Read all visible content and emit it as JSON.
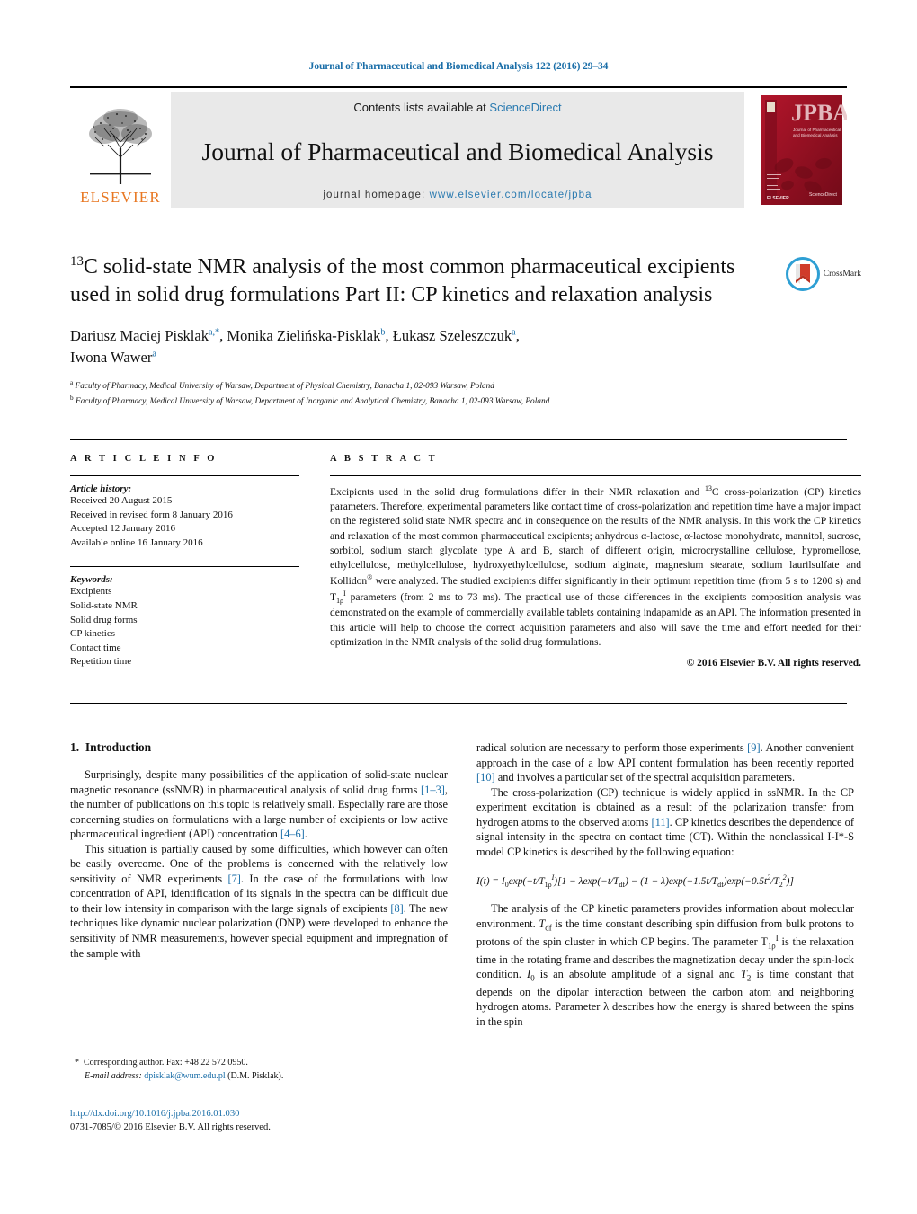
{
  "running_head": "Journal of Pharmaceutical and Biomedical Analysis 122 (2016) 29–34",
  "masthead": {
    "contents_prefix": "Contents lists available at ",
    "sciencedirect": "ScienceDirect",
    "journal_title": "Journal of Pharmaceutical and Biomedical Analysis",
    "homepage_prefix": "journal homepage: ",
    "homepage_url": "www.elsevier.com/locate/jpba",
    "publisher": "ELSEVIER",
    "cover_title": "JPBA",
    "cover_subtitle": "Journal of Pharmaceutical and Biomedical Analysis",
    "accent_orange": "#e87722",
    "accent_blue": "#2a7ab0",
    "cover_red": "#a8142a"
  },
  "article": {
    "title_line1_sup": "13",
    "title": "C solid-state NMR analysis of the most common pharmaceutical excipients used in solid drug formulations Part II: CP kinetics and relaxation analysis",
    "authors_html": "Dariusz Maciej Pisklak, Monika Zielińska-Pisklak, Łukasz Szeleszczuk, Iwona Wawer",
    "affiliation_a": "Faculty of Pharmacy, Medical University of Warsaw, Department of Physical Chemistry, Banacha 1, 02-093 Warsaw, Poland",
    "affiliation_b": "Faculty of Pharmacy, Medical University of Warsaw, Department of Inorganic and Analytical Chemistry, Banacha 1, 02-093 Warsaw, Poland",
    "crossmark_label": "CrossMark"
  },
  "article_info": {
    "heading": "A R T I C L E    I N F O",
    "history_label": "Article history:",
    "history": [
      "Received 20 August 2015",
      "Received in revised form 8 January 2016",
      "Accepted 12 January 2016",
      "Available online 16 January 2016"
    ],
    "keywords_label": "Keywords:",
    "keywords": [
      "Excipients",
      "Solid-state NMR",
      "Solid drug forms",
      "CP kinetics",
      "Contact time",
      "Repetition time"
    ]
  },
  "abstract": {
    "heading": "A B S T R A C T",
    "copyright": "© 2016 Elsevier B.V. All rights reserved."
  },
  "introduction": {
    "section_number": "1.",
    "section_title": "Introduction"
  },
  "footnote": {
    "star": "*",
    "corresponding": "Corresponding author. Fax: +48 22 572 0950.",
    "email_label": "E-mail address:",
    "email": "dpisklak@wum.edu.pl",
    "email_suffix": "(D.M. Pisklak).",
    "doi_url": "http://dx.doi.org/10.1016/j.jpba.2016.01.030",
    "issn_line": "0731-7085/© 2016 Elsevier B.V. All rights reserved."
  }
}
